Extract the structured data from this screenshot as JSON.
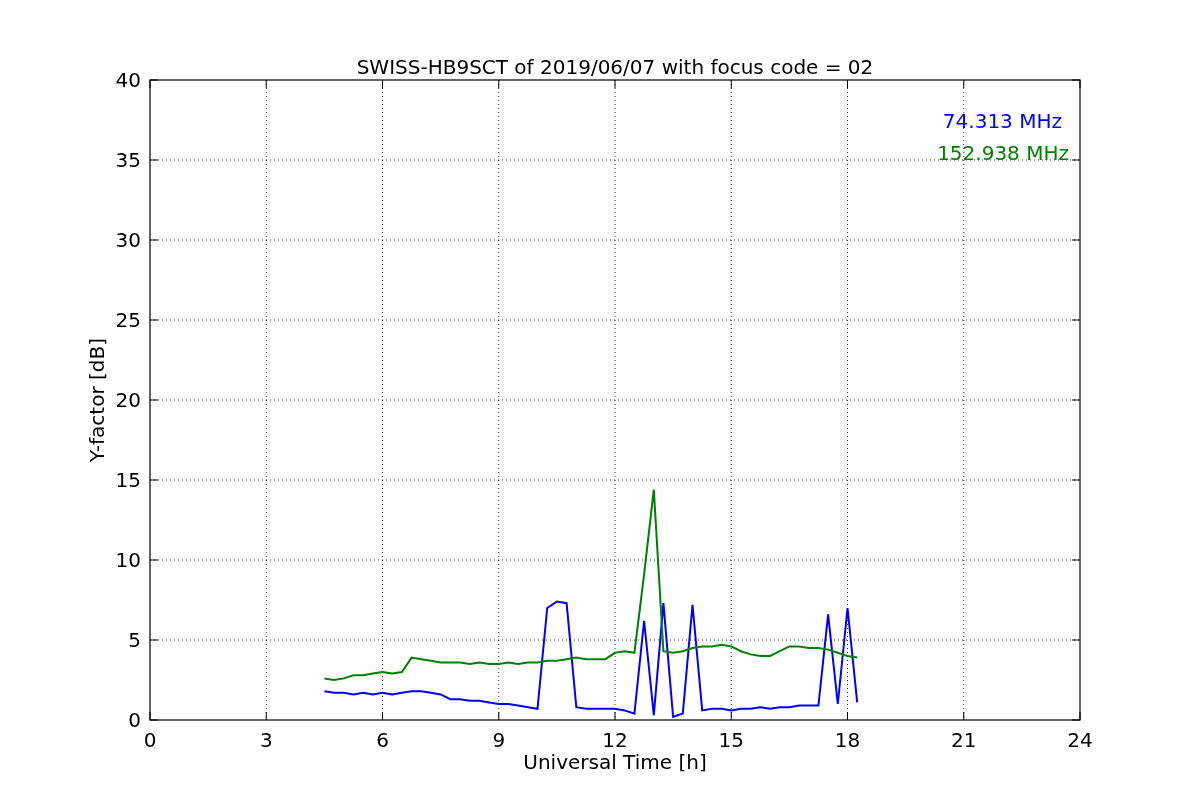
{
  "chart_data": {
    "type": "line",
    "title": "SWISS-HB9SCT of 2019/06/07 with focus code = 02",
    "xlabel": "Universal Time [h]",
    "ylabel": "Y-factor [dB]",
    "x": [
      4.5,
      4.75,
      5,
      5.25,
      5.5,
      5.75,
      6,
      6.25,
      6.5,
      6.75,
      7,
      7.25,
      7.5,
      7.75,
      8,
      8.25,
      8.5,
      8.75,
      9,
      9.25,
      9.5,
      9.75,
      10,
      10.25,
      10.5,
      10.75,
      11,
      11.25,
      11.5,
      11.75,
      12,
      12.25,
      12.5,
      12.75,
      13,
      13.25,
      13.5,
      13.75,
      14,
      14.25,
      14.5,
      14.75,
      15,
      15.25,
      15.5,
      15.75,
      16,
      16.25,
      16.5,
      16.75,
      17,
      17.25,
      17.5,
      17.75,
      18,
      18.25
    ],
    "series": [
      {
        "name": "74.313 MHz",
        "color": "#0000ff",
        "values": [
          1.8,
          1.7,
          1.7,
          1.6,
          1.7,
          1.6,
          1.7,
          1.6,
          1.7,
          1.8,
          1.8,
          1.7,
          1.6,
          1.3,
          1.3,
          1.2,
          1.2,
          1.1,
          1.0,
          1.0,
          0.9,
          0.8,
          0.7,
          7.0,
          7.4,
          7.3,
          0.8,
          0.7,
          0.7,
          0.7,
          0.7,
          0.6,
          0.4,
          6.2,
          0.3,
          7.3,
          0.2,
          0.4,
          7.2,
          0.6,
          0.7,
          0.7,
          0.6,
          0.7,
          0.7,
          0.8,
          0.7,
          0.8,
          0.8,
          0.9,
          0.9,
          0.9,
          6.6,
          1.0,
          7.0,
          1.1
        ]
      },
      {
        "name": "152.938 MHz",
        "color": "#008000",
        "values": [
          2.6,
          2.5,
          2.6,
          2.8,
          2.8,
          2.9,
          3.0,
          2.9,
          3.0,
          3.9,
          3.8,
          3.7,
          3.6,
          3.6,
          3.6,
          3.5,
          3.6,
          3.5,
          3.5,
          3.6,
          3.5,
          3.6,
          3.6,
          3.7,
          3.7,
          3.8,
          3.9,
          3.8,
          3.8,
          3.8,
          4.2,
          4.3,
          4.2,
          9.1,
          14.4,
          4.3,
          4.2,
          4.3,
          4.5,
          4.6,
          4.6,
          4.7,
          4.6,
          4.3,
          4.1,
          4.0,
          4.0,
          4.3,
          4.6,
          4.6,
          4.5,
          4.5,
          4.4,
          4.2,
          4.0,
          3.9
        ]
      }
    ],
    "grid": true,
    "xlim": [
      0,
      24
    ],
    "ylim": [
      0,
      40
    ],
    "xticks": [
      0,
      3,
      6,
      9,
      12,
      15,
      18,
      21,
      24
    ],
    "yticks": [
      0,
      5,
      10,
      15,
      20,
      25,
      30,
      35,
      40
    ]
  }
}
